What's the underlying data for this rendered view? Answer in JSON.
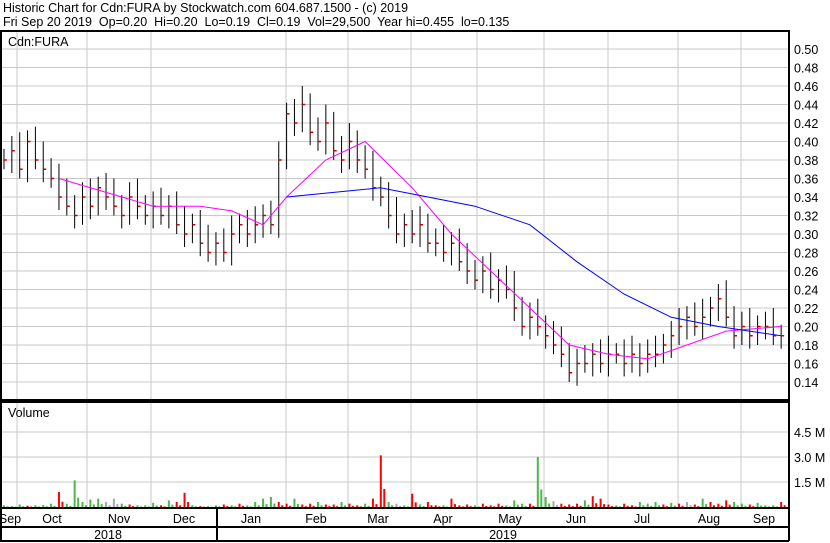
{
  "header": {
    "title": "Historic Chart for Cdn:FURA by Stockwatch.com 604.687.1500 - (c) 2019",
    "quote": "Fri Sep 20 2019  Op=0.20  Hi=0.20  Lo=0.19  Cl=0.19  Vol=29,500  Year hi=0.455  lo=0.135"
  },
  "chart_data": {
    "type": "ohlc-bar",
    "symbol_label": "Cdn:FURA",
    "volume_label": "Volume",
    "price_axis": {
      "ylim": [
        0.13,
        0.51
      ],
      "ticks": [
        "0.50",
        "0.48",
        "0.46",
        "0.44",
        "0.42",
        "0.40",
        "0.38",
        "0.36",
        "0.34",
        "0.32",
        "0.30",
        "0.28",
        "0.26",
        "0.24",
        "0.22",
        "0.20",
        "0.18",
        "0.16",
        "0.14"
      ]
    },
    "volume_axis": {
      "ylim_millions": [
        0,
        6.1
      ],
      "ticks": [
        "4.5 M",
        "3.0 M",
        "1.5 M"
      ]
    },
    "months": [
      "Sep",
      "Oct",
      "Nov",
      "Dec",
      "Jan",
      "Feb",
      "Mar",
      "Apr",
      "May",
      "Jun",
      "Jul",
      "Aug",
      "Sep"
    ],
    "years": [
      "2018",
      "2019"
    ],
    "closes": [
      0.38,
      0.39,
      0.37,
      0.4,
      0.38,
      0.37,
      0.36,
      0.34,
      0.33,
      0.32,
      0.34,
      0.33,
      0.35,
      0.34,
      0.33,
      0.32,
      0.34,
      0.33,
      0.32,
      0.33,
      0.32,
      0.33,
      0.31,
      0.3,
      0.31,
      0.29,
      0.28,
      0.29,
      0.28,
      0.3,
      0.31,
      0.3,
      0.31,
      0.32,
      0.31,
      0.38,
      0.43,
      0.42,
      0.44,
      0.41,
      0.4,
      0.42,
      0.39,
      0.38,
      0.4,
      0.38,
      0.37,
      0.35,
      0.34,
      0.32,
      0.3,
      0.31,
      0.3,
      0.31,
      0.29,
      0.29,
      0.28,
      0.29,
      0.27,
      0.26,
      0.25,
      0.26,
      0.24,
      0.25,
      0.24,
      0.22,
      0.2,
      0.21,
      0.2,
      0.19,
      0.18,
      0.17,
      0.15,
      0.16,
      0.16,
      0.17,
      0.16,
      0.17,
      0.17,
      0.16,
      0.17,
      0.16,
      0.17,
      0.17,
      0.18,
      0.19,
      0.2,
      0.21,
      0.2,
      0.21,
      0.22,
      0.23,
      0.21,
      0.19,
      0.2,
      0.19,
      0.2,
      0.2,
      0.19,
      0.19
    ],
    "volumes_millions": [
      0.1,
      0.05,
      0.15,
      0.08,
      0.1,
      0.12,
      0.2,
      0.9,
      0.2,
      1.6,
      0.3,
      0.45,
      0.5,
      0.3,
      0.5,
      0.2,
      0.15,
      0.1,
      0.1,
      0.25,
      0.1,
      0.4,
      0.3,
      0.85,
      0.1,
      0.05,
      0.05,
      0.1,
      0.15,
      0.1,
      0.2,
      0.1,
      0.3,
      0.5,
      0.6,
      0.3,
      0.2,
      0.5,
      0.15,
      0.2,
      0.3,
      0.15,
      0.15,
      0.3,
      0.2,
      0.1,
      0.2,
      0.5,
      3.1,
      0.3,
      0.2,
      0.1,
      0.8,
      0.15,
      0.3,
      0.1,
      0.1,
      0.5,
      0.1,
      0.15,
      0.1,
      0.2,
      0.1,
      0.2,
      0.1,
      0.4,
      0.2,
      0.2,
      3.0,
      0.6,
      0.35,
      0.2,
      0.15,
      0.2,
      0.4,
      0.65,
      0.5,
      0.15,
      0.1,
      0.2,
      0.1,
      0.3,
      0.2,
      0.3,
      0.15,
      0.25,
      0.2,
      0.3,
      0.15,
      0.5,
      0.3,
      0.2,
      0.4,
      0.3,
      0.2,
      0.15,
      0.25,
      0.1,
      0.1,
      0.3
    ],
    "volume_colors": "gggrgggrgggggxxgrgggrgrrgrggrgrggggrrgrrgrrgrrgrrgxgrgrrgrrrgrrrgggrggxrrrgrrrgrrgggrgrxrgrrrggrgggrggr",
    "ma_short": {
      "color": "#ff00ff",
      "points": [
        [
          7,
          0.36
        ],
        [
          13,
          0.345
        ],
        [
          19,
          0.33
        ],
        [
          25,
          0.33
        ],
        [
          29,
          0.325
        ],
        [
          33,
          0.31
        ],
        [
          36,
          0.34
        ],
        [
          41,
          0.38
        ],
        [
          46,
          0.4
        ],
        [
          52,
          0.35
        ],
        [
          57,
          0.3
        ],
        [
          62,
          0.26
        ],
        [
          67,
          0.22
        ],
        [
          72,
          0.18
        ],
        [
          77,
          0.17
        ],
        [
          82,
          0.165
        ],
        [
          87,
          0.18
        ],
        [
          92,
          0.195
        ],
        [
          99,
          0.2
        ]
      ]
    },
    "ma_long": {
      "color": "#0000ff",
      "points": [
        [
          36,
          0.34
        ],
        [
          42,
          0.345
        ],
        [
          48,
          0.35
        ],
        [
          54,
          0.34
        ],
        [
          60,
          0.33
        ],
        [
          67,
          0.31
        ],
        [
          73,
          0.27
        ],
        [
          79,
          0.235
        ],
        [
          85,
          0.21
        ],
        [
          91,
          0.2
        ],
        [
          99,
          0.19
        ]
      ]
    }
  }
}
